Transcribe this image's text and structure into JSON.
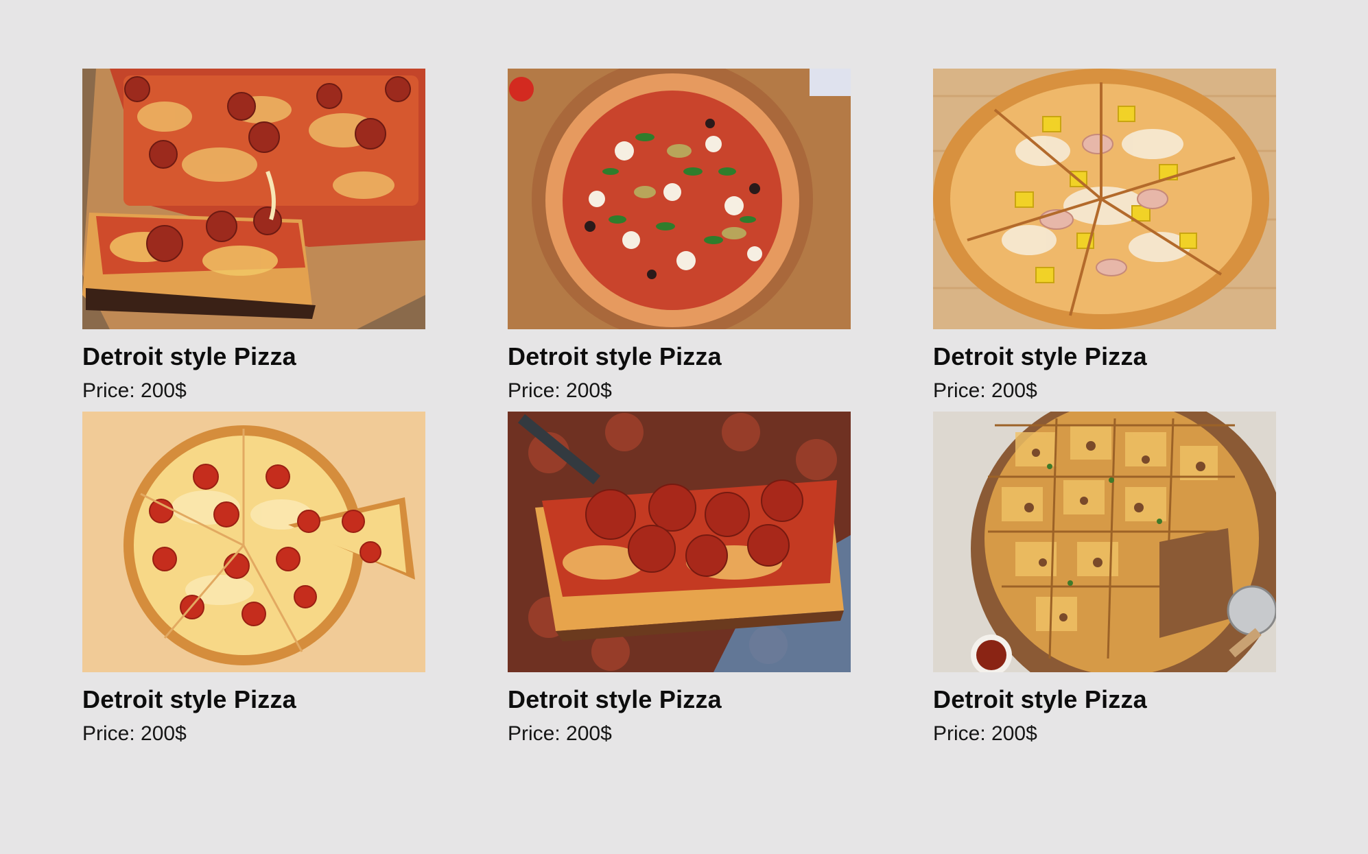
{
  "products": [
    {
      "name": "Detroit style Pizza",
      "price": "Price: 200$",
      "image_icon": "pizza-pepperoni-square-photo"
    },
    {
      "name": "Detroit style Pizza",
      "price": "Price: 200$",
      "image_icon": "pizza-veggie-round-photo"
    },
    {
      "name": "Detroit style Pizza",
      "price": "Price: 200$",
      "image_icon": "pizza-hawaiian-round-photo"
    },
    {
      "name": "Detroit style Pizza",
      "price": "Price: 200$",
      "image_icon": "pizza-pepperoni-round-photo"
    },
    {
      "name": "Detroit style Pizza",
      "price": "Price: 200$",
      "image_icon": "pizza-slice-spatula-photo"
    },
    {
      "name": "Detroit style Pizza",
      "price": "Price: 200$",
      "image_icon": "pizza-sausage-tavern-photo"
    }
  ],
  "colors": {
    "page_background": "#e6e5e6",
    "text": "#111111"
  }
}
